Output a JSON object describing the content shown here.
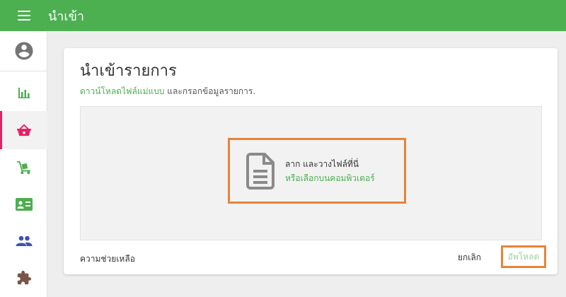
{
  "app": {
    "title": "นำเข้า"
  },
  "sidebar": {
    "items": [
      {
        "icon": "account-circle-icon"
      },
      {
        "icon": "bar-chart-icon"
      },
      {
        "icon": "basket-icon",
        "active": true
      },
      {
        "icon": "hand-truck-icon"
      },
      {
        "icon": "contact-card-icon"
      },
      {
        "icon": "people-icon"
      },
      {
        "icon": "puzzle-icon"
      }
    ]
  },
  "import_card": {
    "title": "นำเข้ารายการ",
    "template_link": "ดาวน์โหลดไฟล์แม่แบบ",
    "instruction_rest": " และกรอกข้อมูลรายการ.",
    "dropzone": {
      "main_text": "ลาก และวางไฟล์ที่นี่",
      "browse_link": "หรือเลือกบนคอมพิวเตอร์"
    },
    "help_label": "ความช่วยเหลือ",
    "cancel_label": "ยกเลิก",
    "upload_label": "อัพโหลด"
  },
  "colors": {
    "appbar": "#4caf50",
    "link": "#4caf50",
    "sidebar_icon": "#4caf50",
    "active_indicator": "#e91e63",
    "highlight_outline": "#e8833a"
  }
}
